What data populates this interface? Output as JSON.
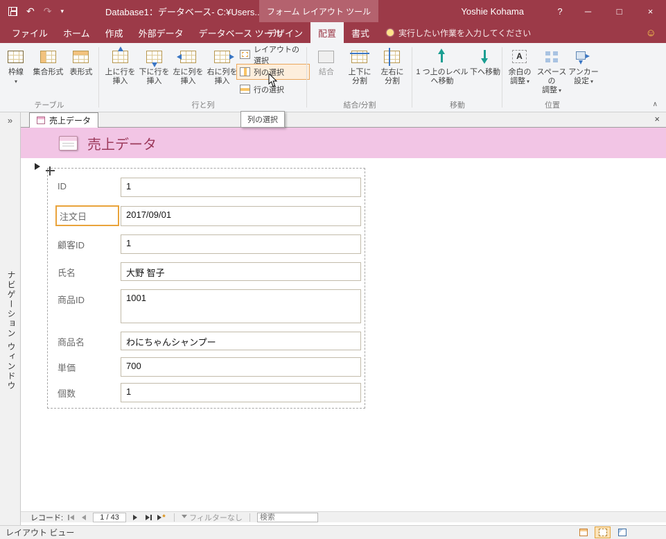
{
  "titlebar": {
    "title": "Database1：データベース- C:¥Users...",
    "contextual": "フォーム レイアウト ツール",
    "user": "Yoshie Kohama"
  },
  "icons": {
    "undo": "↶",
    "redo": "↷",
    "qat_more": "▾",
    "help": "?",
    "minimize": "─",
    "maximize": "□",
    "close": "×",
    "doc_close": "×",
    "smiley": "☺",
    "nav_expand": "»",
    "ribbon_collapse": "∧",
    "dropdown": "▾",
    "margins_glyph": "A",
    "new_record_star": "*"
  },
  "tabs": [
    {
      "label": "ファイル"
    },
    {
      "label": "ホーム"
    },
    {
      "label": "作成"
    },
    {
      "label": "外部データ"
    },
    {
      "label": "データベース ツール"
    }
  ],
  "ctx_tabs": [
    {
      "label": "デザイン"
    },
    {
      "label": "配置"
    },
    {
      "label": "書式"
    }
  ],
  "tellme": "実行したい作業を入力してください",
  "ribbon": {
    "table_group": {
      "label": "テーブル",
      "gridlines": "枠線",
      "stacked": "集合形式",
      "tabular": "表形式"
    },
    "rows_group": {
      "label": "行と列",
      "buttons": [
        {
          "l1": "上に行を",
          "l2": "挿入"
        },
        {
          "l1": "下に行を",
          "l2": "挿入"
        },
        {
          "l1": "左に列を",
          "l2": "挿入"
        },
        {
          "l1": "右に列を",
          "l2": "挿入"
        }
      ],
      "select_buttons": [
        {
          "label": "レイアウトの選択"
        },
        {
          "label": "列の選択"
        },
        {
          "label": "行の選択"
        }
      ]
    },
    "merge_group": {
      "label": "結合/分割",
      "buttons": [
        {
          "l1": "結合",
          "l2": ""
        },
        {
          "l1": "上下に",
          "l2": "分割"
        },
        {
          "l1": "左右に",
          "l2": "分割"
        }
      ]
    },
    "move_group": {
      "label": "移動",
      "buttons": [
        {
          "l1": "1 つ上のレベル",
          "l2": "へ移動"
        },
        {
          "l1": "下へ移動",
          "l2": ""
        }
      ]
    },
    "position_group": {
      "label": "位置",
      "buttons": [
        {
          "l1": "余白の",
          "l2": "調整"
        },
        {
          "l1": "スペースの",
          "l2": "調整"
        },
        {
          "l1": "アンカー",
          "l2": "設定"
        }
      ]
    }
  },
  "tooltip": "列の選択",
  "document": {
    "tab_label": "売上データ",
    "header_title": "売上データ",
    "fields": [
      {
        "label": "ID",
        "value": "1"
      },
      {
        "label": "注文日",
        "value": "2017/09/01"
      },
      {
        "label": "顧客ID",
        "value": "1"
      },
      {
        "label": "氏名",
        "value": "大野 智子"
      },
      {
        "label": "商品ID",
        "value": "1001"
      },
      {
        "label": "商品名",
        "value": "わにちゃんシャンプー"
      },
      {
        "label": "単価",
        "value": "700"
      },
      {
        "label": "個数",
        "value": "1"
      }
    ]
  },
  "navpane": {
    "title": "ナビゲーション ウィンドウ"
  },
  "recordnav": {
    "label": "レコード:",
    "position": "1 / 43",
    "filter": "フィルターなし",
    "search_placeholder": "検索"
  },
  "statusbar": {
    "view": "レイアウト ビュー"
  },
  "colors": {
    "accent": "#9c3a48",
    "header_pink": "#f2c5e5",
    "selection_orange": "#e9a33b"
  }
}
